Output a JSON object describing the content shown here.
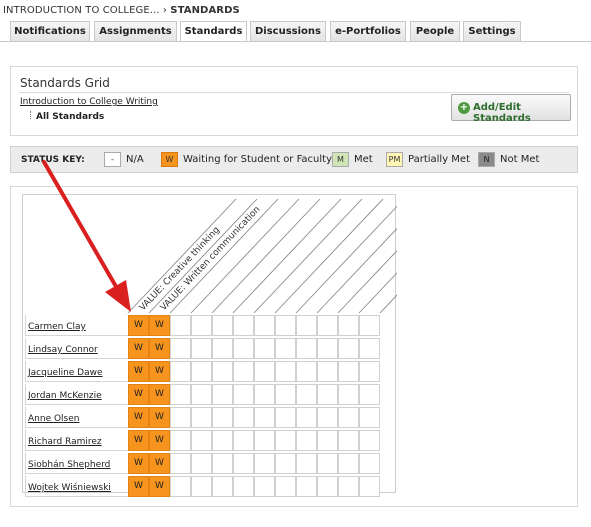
{
  "breadcrumb": {
    "parent": "INTRODUCTION TO COLLEGE...",
    "separator": "›",
    "current": "STANDARDS"
  },
  "tabs": [
    {
      "label": "Notifications"
    },
    {
      "label": "Assignments"
    },
    {
      "label": "Standards",
      "active": true
    },
    {
      "label": "Discussions"
    },
    {
      "label": "e-Portfolios"
    },
    {
      "label": "People"
    },
    {
      "label": "Settings"
    }
  ],
  "standards_panel": {
    "title": "Standards Grid",
    "course_link": "Introduction to College Writing",
    "all_standards": "All Standards",
    "add_button": "Add/Edit Standards",
    "add_icon": "plus-circle-icon"
  },
  "status_key": {
    "label": "STATUS KEY:",
    "items": [
      {
        "code": "-",
        "text": "N/A",
        "color": "#ffffff"
      },
      {
        "code": "W",
        "text": "Waiting for Student or Faculty",
        "color": "#f7941d"
      },
      {
        "code": "M",
        "text": "Met",
        "color": "#cfe5b6"
      },
      {
        "code": "PM",
        "text": "Partially Met",
        "color": "#fff7b3"
      },
      {
        "code": "N",
        "text": "Not Met",
        "color": "#8a8a8a"
      }
    ]
  },
  "grid": {
    "columns": [
      "VALUE: Creative thinking",
      "VALUE: Written communication"
    ],
    "students": [
      {
        "name": "Carmen Clay",
        "values": [
          "W",
          "W"
        ]
      },
      {
        "name": "Lindsay Connor",
        "values": [
          "W",
          "W"
        ]
      },
      {
        "name": "Jacqueline Dawe",
        "values": [
          "W",
          "W"
        ]
      },
      {
        "name": "Jordan McKenzie",
        "values": [
          "W",
          "W"
        ]
      },
      {
        "name": "Anne Olsen",
        "values": [
          "W",
          "W"
        ]
      },
      {
        "name": "Richard Ramirez",
        "values": [
          "W",
          "W"
        ]
      },
      {
        "name": "Siobhán Shepherd",
        "values": [
          "W",
          "W"
        ]
      },
      {
        "name": "Wojtek Wiśniewski",
        "values": [
          "W",
          "W"
        ]
      }
    ]
  },
  "annotation": {
    "arrow_color": "#d9201f"
  }
}
